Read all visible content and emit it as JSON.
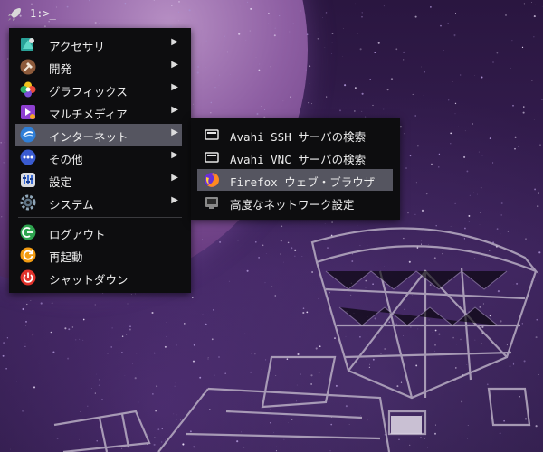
{
  "taskbar": {
    "workspace_label": "1:>_"
  },
  "main_menu": {
    "items": [
      {
        "label": "アクセサリ",
        "icon": "accessories-icon",
        "has_submenu": true
      },
      {
        "label": "開発",
        "icon": "development-hammer-icon",
        "has_submenu": true
      },
      {
        "label": "グラフィックス",
        "icon": "graphics-flower-icon",
        "has_submenu": true
      },
      {
        "label": "マルチメディア",
        "icon": "multimedia-icon",
        "has_submenu": true
      },
      {
        "label": "インターネット",
        "icon": "internet-globe-icon",
        "has_submenu": true,
        "selected": true
      },
      {
        "label": "その他",
        "icon": "other-dots-icon",
        "has_submenu": true
      },
      {
        "label": "設定",
        "icon": "settings-icon",
        "has_submenu": true
      },
      {
        "label": "システム",
        "icon": "system-gear-icon",
        "has_submenu": true
      },
      {
        "label": "ログアウト",
        "icon": "logout-icon",
        "has_submenu": false
      },
      {
        "label": "再起動",
        "icon": "reboot-icon",
        "has_submenu": false
      },
      {
        "label": "シャットダウン",
        "icon": "shutdown-icon",
        "has_submenu": false
      }
    ],
    "arrow_glyph": "▶"
  },
  "sub_menu": {
    "items": [
      {
        "label": "Avahi SSH サーバの検索",
        "icon": "network-server-icon"
      },
      {
        "label": "Avahi VNC サーバの検索",
        "icon": "network-server-icon"
      },
      {
        "label": "Firefox ウェブ・ブラウザ",
        "icon": "firefox-icon",
        "selected": true
      },
      {
        "label": "高度なネットワーク設定",
        "icon": "network-settings-icon"
      }
    ]
  },
  "colors": {
    "menu_background": "#0d0d0f",
    "selection": "#555560",
    "text": "#ececec"
  }
}
